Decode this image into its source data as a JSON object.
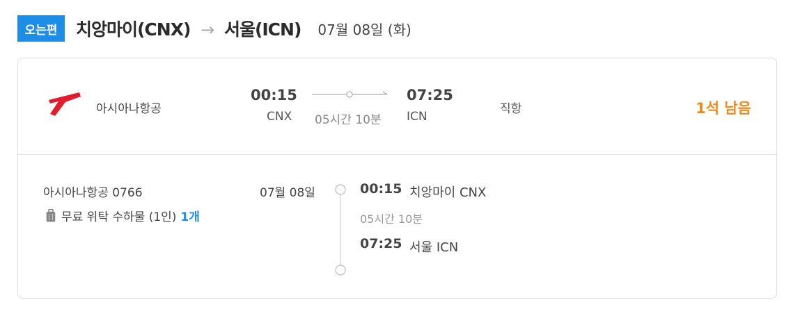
{
  "header": {
    "badge": "오는편",
    "origin": "치앙마이(CNX)",
    "arrow": "→",
    "destination": "서울(ICN)",
    "date": "07월 08일 (화)"
  },
  "summary": {
    "airline_logo": "asiana-logo-icon",
    "airline": "아시아나항공",
    "departure_time": "00:15",
    "departure_code": "CNX",
    "duration": "05시간 10분",
    "arrival_time": "07:25",
    "arrival_code": "ICN",
    "stops": "직항",
    "seats_left": "1석 남음"
  },
  "detail": {
    "flight_number": "아시아나항공 0766",
    "baggage_icon": "luggage-icon",
    "baggage_label": "무료 위탁 수하물 (1인)",
    "baggage_count": "1개",
    "date": "07월 08일",
    "departure_time": "00:15",
    "departure_place": "치앙마이 CNX",
    "duration": "05시간 10분",
    "arrival_time": "07:25",
    "arrival_place": "서울 ICN"
  },
  "colors": {
    "badge_blue": "#1e8de8",
    "seats_orange": "#ef8b1a",
    "asiana_red": "#e21c2a",
    "baggage_count_blue": "#1e8de8"
  }
}
